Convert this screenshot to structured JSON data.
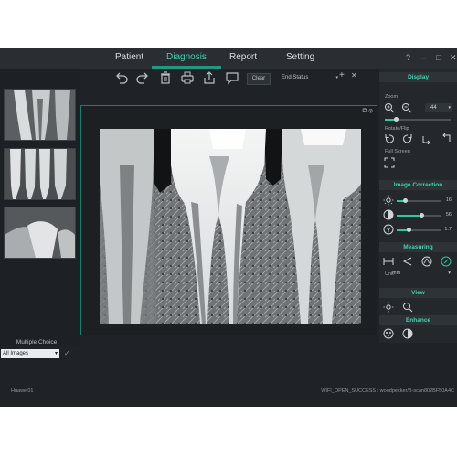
{
  "nav": {
    "tabs": [
      "Patient",
      "Diagnosis",
      "Report",
      "Setting"
    ],
    "active_tab": "Diagnosis",
    "window_controls": [
      "?",
      "–",
      "□",
      "✕"
    ]
  },
  "thumbnails": {
    "items": [
      "thumb-1",
      "thumb-2",
      "thumb-3"
    ],
    "multiple_choice_label": "Multiple Choice",
    "image_filter": "All Images"
  },
  "toolbar": {
    "clear_label": "Clear",
    "status_value": "End Status",
    "icons": [
      "undo-icon",
      "redo-icon",
      "trash-icon",
      "print-icon",
      "export-icon",
      "comment-icon"
    ]
  },
  "right_panel": {
    "display_title": "Display",
    "zoom_label": "Zoom",
    "zoom_value": "44",
    "rotate_label": "Rotate/Flip",
    "fullscreen_label": "Full Screen",
    "image_correction_title": "Image Correction",
    "brightness_value": "16",
    "contrast_value": "56",
    "gamma_value": "1.7",
    "brightness_level": 0.18,
    "contrast_level": 0.56,
    "gamma_level": 0.28,
    "measuring_title": "Measuring",
    "unit_label": "Unit",
    "unit_value": "mm",
    "view_title": "View",
    "enhance_title": "Enhance"
  },
  "statusbar": {
    "left": "Huawei01",
    "right": "WIFI_OPEN_SUCCESS : woodpecker/B-scan802BF50A4C"
  },
  "colors": {
    "accent": "#3fd1b0",
    "background": "#1f2226",
    "border": "#1c7d6a"
  }
}
